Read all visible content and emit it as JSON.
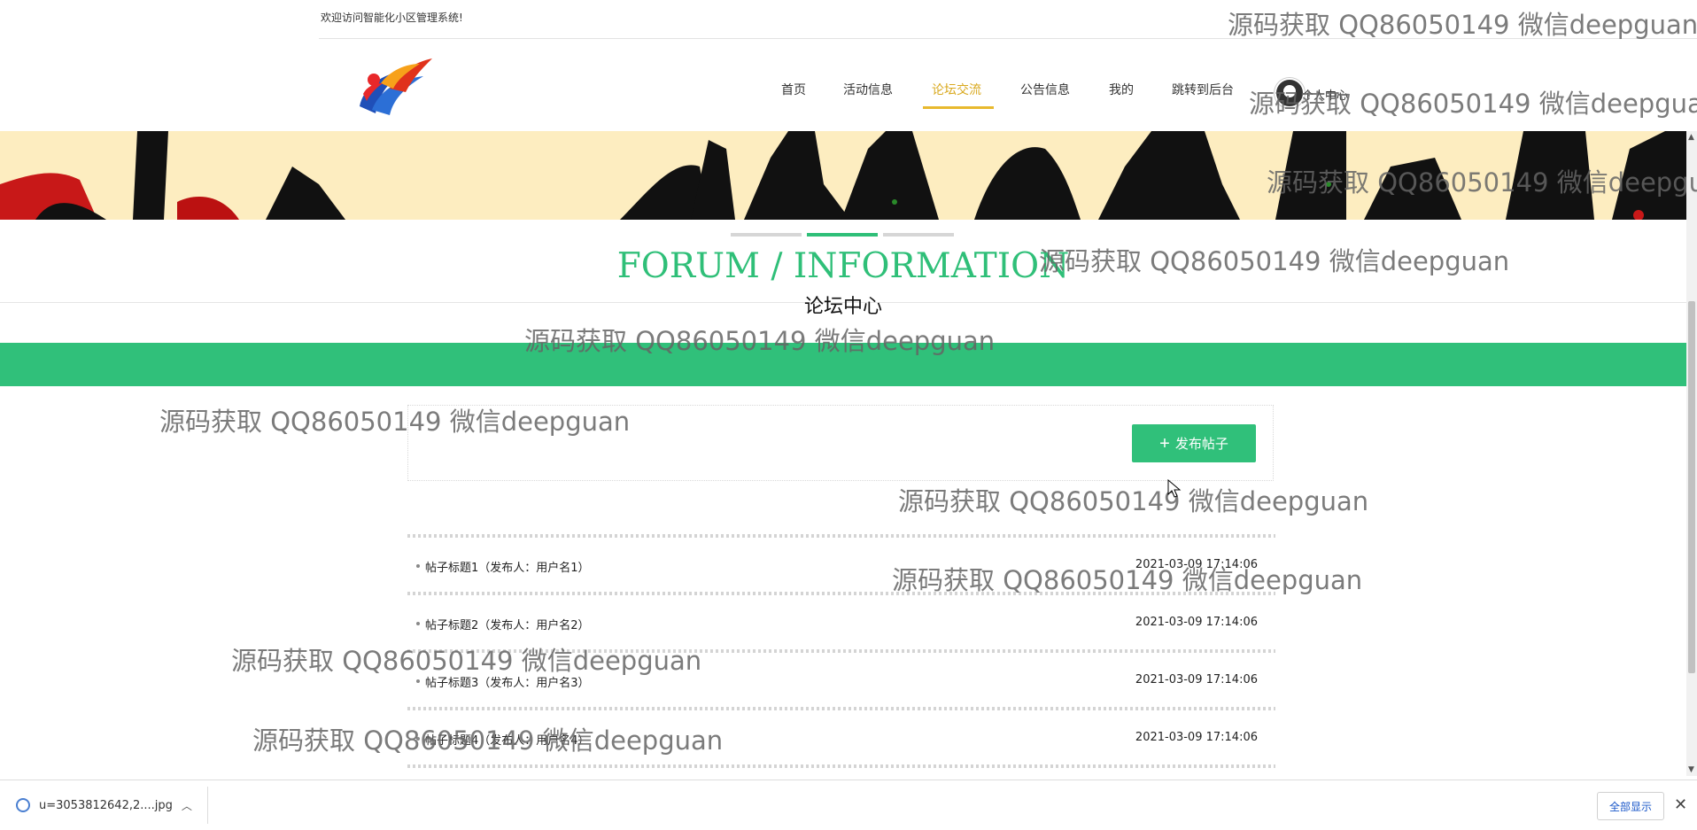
{
  "header": {
    "welcome": "欢迎访问智能化小区管理系统!"
  },
  "nav": {
    "items": [
      {
        "label": "首页"
      },
      {
        "label": "活动信息"
      },
      {
        "label": "论坛交流"
      },
      {
        "label": "公告信息"
      },
      {
        "label": "我的"
      },
      {
        "label": "跳转到后台"
      }
    ],
    "active_index": 2,
    "user_label": "个人中心"
  },
  "section": {
    "title": "FORUM / INFORMATION",
    "subtitle": "论坛中心"
  },
  "actions": {
    "publish_label": "发布帖子"
  },
  "posts": [
    {
      "title": "帖子标题1（发布人：用户名1）",
      "time": "2021-03-09 17:14:06"
    },
    {
      "title": "帖子标题2（发布人：用户名2）",
      "time": "2021-03-09 17:14:06"
    },
    {
      "title": "帖子标题3（发布人：用户名3）",
      "time": "2021-03-09 17:14:06"
    },
    {
      "title": "帖子标题4（发布人：用户名4）",
      "time": "2021-03-09 17:14:06"
    }
  ],
  "watermark": "源码获取 QQ86050149 微信deepguan",
  "download_bar": {
    "filename": "u=3053812642,2....jpg",
    "show_all": "全部显示"
  },
  "colors": {
    "accent": "#30c07a",
    "nav_active": "#d9a91f",
    "banner_bg": "#fdedc0"
  },
  "icons": {
    "publish": "plus-icon",
    "download_file": "image-file-icon",
    "expand": "chevron-up-icon",
    "close": "close-icon"
  }
}
